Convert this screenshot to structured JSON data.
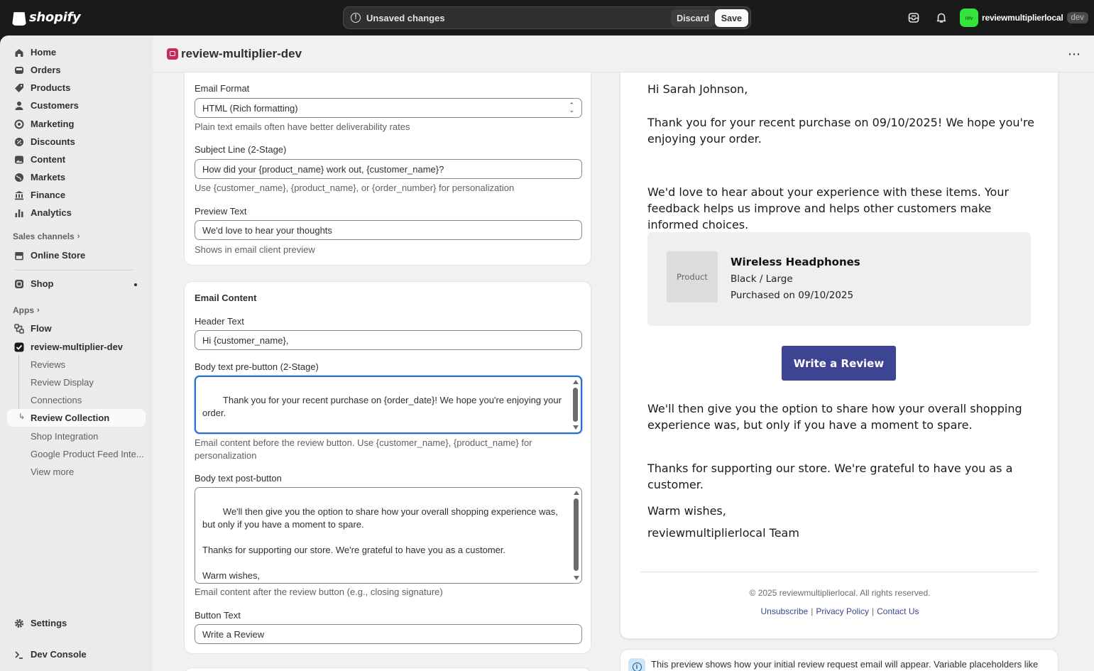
{
  "topbar": {
    "brand": "shopify",
    "unsaved_text": "Unsaved changes",
    "discard_label": "Discard",
    "save_label": "Save",
    "store_initials": "rev",
    "store_name": "reviewmultiplierlocal",
    "store_badge": "dev"
  },
  "sidebar": {
    "items": [
      {
        "label": "Home",
        "icon": "home-icon"
      },
      {
        "label": "Orders",
        "icon": "inbox-icon"
      },
      {
        "label": "Products",
        "icon": "tag-icon"
      },
      {
        "label": "Customers",
        "icon": "person-icon"
      },
      {
        "label": "Marketing",
        "icon": "target-icon"
      },
      {
        "label": "Discounts",
        "icon": "discount-icon"
      },
      {
        "label": "Content",
        "icon": "image-icon"
      },
      {
        "label": "Markets",
        "icon": "globe-icon"
      },
      {
        "label": "Finance",
        "icon": "bank-icon"
      },
      {
        "label": "Analytics",
        "icon": "chart-icon"
      }
    ],
    "sales_channels_label": "Sales channels",
    "online_store": "Online Store",
    "shop": "Shop",
    "apps_label": "Apps",
    "flow": "Flow",
    "app_name": "review-multiplier-dev",
    "app_subitems": [
      "Reviews",
      "Review Display",
      "Connections",
      "Review Collection",
      "Shop Integration",
      "Google Product Feed Inte...",
      "View more"
    ],
    "settings": "Settings",
    "dev_console": "Dev Console"
  },
  "app_header": {
    "title": "review-multiplier-dev"
  },
  "form": {
    "email_format_label": "Email Format",
    "email_format_value": "HTML (Rich formatting)",
    "email_format_help": "Plain text emails often have better deliverability rates",
    "subject_label": "Subject Line (2-Stage)",
    "subject_value": "How did your {product_name} work out, {customer_name}?",
    "subject_help": "Use {customer_name}, {product_name}, or {order_number} for personalization",
    "preview_label": "Preview Text",
    "preview_value": "We'd love to hear your thoughts",
    "preview_help": "Shows in email client preview",
    "content_title": "Email Content",
    "header_label": "Header Text",
    "header_value": "Hi {customer_name},",
    "pre_label": "Body text pre-button (2-Stage)",
    "pre_value": "Thank you for your recent purchase on {order_date}! We hope you're enjoying your order.\n\nWe'd love to hear about your experience with these items. Your feedback helps us improve and helps other customers make informed choices.",
    "pre_help": "Email content before the review button. Use {customer_name}, {product_name} for personalization",
    "post_label": "Body text post-button",
    "post_value": "We'll then give you the option to share how your overall shopping experience was, but only if you have a moment to spare.\n\nThanks for supporting our store. We're grateful to have you as a customer.\n\nWarm wishes,\n{store_name} Team",
    "post_help": "Email content after the review button (e.g., closing signature)",
    "button_label": "Button Text",
    "button_value": "Write a Review"
  },
  "preview": {
    "greeting": "Hi Sarah Johnson,",
    "para1": "Thank you for your recent purchase on 09/10/2025! We hope you're enjoying your order.",
    "para2": "We'd love to hear about your experience with these items. Your feedback helps us improve and helps other customers make informed choices.",
    "product_placeholder": "Product",
    "product_name": "Wireless Headphones",
    "product_variant": "Black / Large",
    "product_purchased": "Purchased on 09/10/2025",
    "button": "Write a Review",
    "para3": "We'll then give you the option to share how your overall shopping experience was, but only if you have a moment to spare.",
    "para4": "Thanks for supporting our store. We're grateful to have you as a customer.",
    "signoff": "Warm wishes,",
    "signature": "reviewmultiplierlocal Team",
    "copyright": "© 2025 reviewmultiplierlocal. All rights reserved.",
    "links": [
      "Unsubscribe",
      "Privacy Policy",
      "Contact Us"
    ],
    "info_text": "This preview shows how your initial review request email will appear. Variable placeholders like"
  },
  "colors": {
    "topbar_bg": "#1a1a1a",
    "focus_blue": "#2c6ecb",
    "review_button": "#3d4592",
    "store_avatar": "#36e23c"
  }
}
